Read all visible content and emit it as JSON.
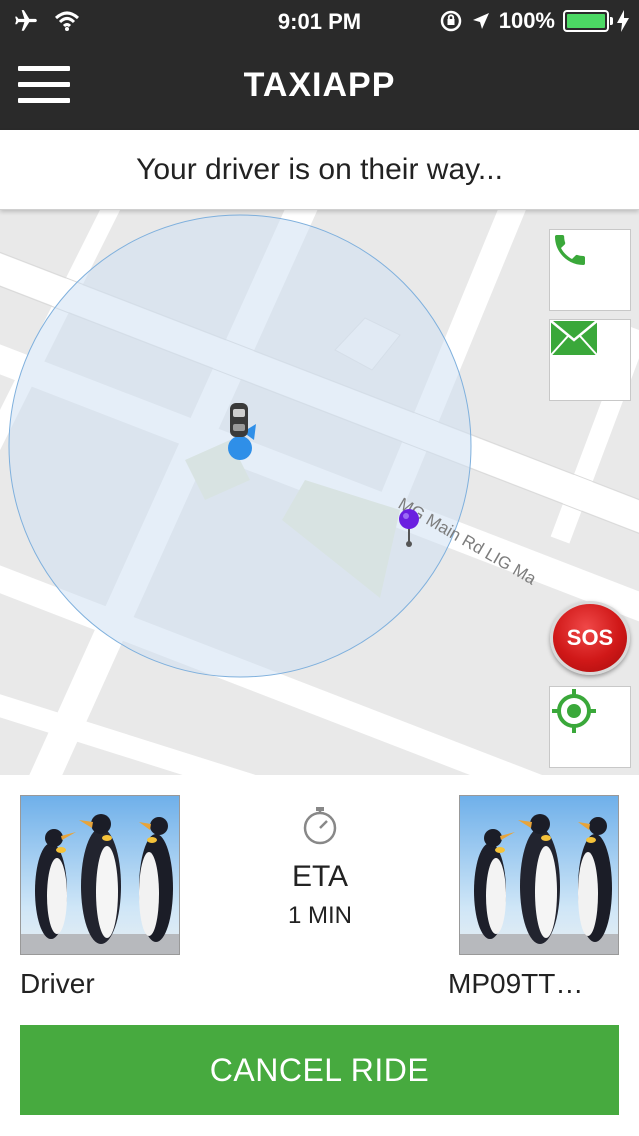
{
  "status_bar": {
    "time": "9:01 PM",
    "battery_percent": "100%",
    "battery_level": 1.0,
    "icons": [
      "airplane-icon",
      "wifi-icon",
      "orientation-lock-icon",
      "location-arrow-icon",
      "battery-icon",
      "charging-icon"
    ]
  },
  "header": {
    "title": "TAXIAPP",
    "menu_icon": "hamburger-menu-icon"
  },
  "banner": {
    "message": "Your driver is on their way..."
  },
  "map": {
    "street_label": "MG Main Rd LIG Ma",
    "buttons": {
      "call_icon": "phone-icon",
      "message_icon": "envelope-icon",
      "sos_label": "SOS",
      "locate_icon": "crosshair-icon"
    }
  },
  "trip": {
    "driver_label": "Driver",
    "vehicle_plate": "MP09TT…",
    "eta_label": "ETA",
    "eta_value": "1 MIN",
    "eta_icon": "stopwatch-icon",
    "cancel_label": "CANCEL RIDE"
  },
  "colors": {
    "header_bg": "#2a2a2a",
    "accent_green": "#47aa3f",
    "sos_red": "#d01818",
    "radius_fill": "#cfe0f2",
    "user_dot": "#2f8fe8",
    "destination_pin": "#6a1fe0"
  }
}
